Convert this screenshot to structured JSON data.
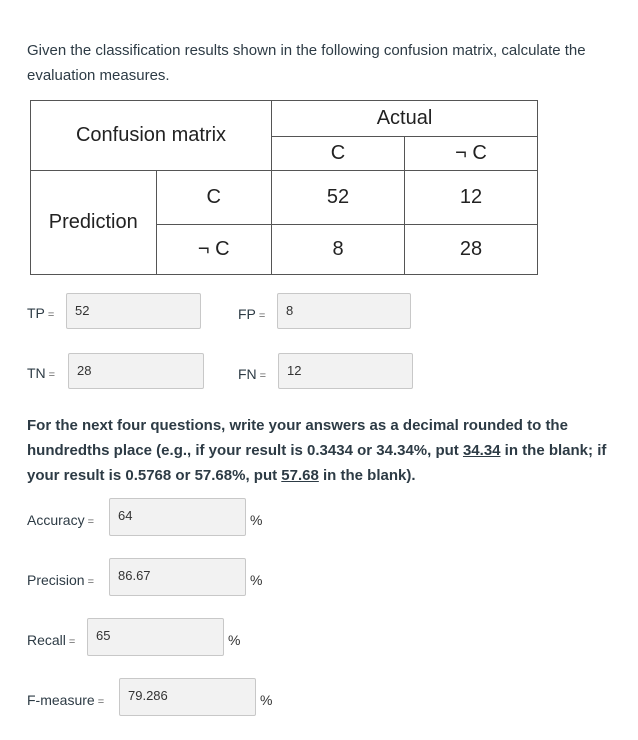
{
  "question": {
    "intro": "Given the classification results shown in the following confusion matrix, calculate the evaluation measures."
  },
  "matrix": {
    "title": "Confusion matrix",
    "actual_label": "Actual",
    "prediction_label": "Prediction",
    "col_headers": [
      "C",
      "¬ C"
    ],
    "row_headers": [
      "C",
      "¬ C"
    ],
    "cells": [
      [
        "52",
        "12"
      ],
      [
        "8",
        "28"
      ]
    ]
  },
  "counts": {
    "tp": {
      "label": "TP",
      "eq": "=",
      "value": "52"
    },
    "fp": {
      "label": "FP",
      "eq": "=",
      "value": "8"
    },
    "tn": {
      "label": "TN",
      "eq": "=",
      "value": "28"
    },
    "fn": {
      "label": "FN",
      "eq": "=",
      "value": "12"
    }
  },
  "instructions": {
    "part1": "For the next four questions, write your answers as a decimal rounded to the hundredths place (e.g., if your result is 0.3434 or 34.34%, put ",
    "ex1": "34.34",
    "part2": " in the blank; if your result is 0.5768 or 57.68%, put ",
    "ex2": "57.68",
    "part3": " in the blank)."
  },
  "measures": {
    "accuracy": {
      "label": "Accuracy",
      "eq": "=",
      "value": "64",
      "unit": "%"
    },
    "precision": {
      "label": "Precision",
      "eq": "=",
      "value": "86.67",
      "unit": "%"
    },
    "recall": {
      "label": "Recall",
      "eq": "=",
      "value": "65",
      "unit": "%"
    },
    "fmeasure": {
      "label": "F-measure",
      "eq": "=",
      "value": "79.286",
      "unit": "%"
    }
  }
}
